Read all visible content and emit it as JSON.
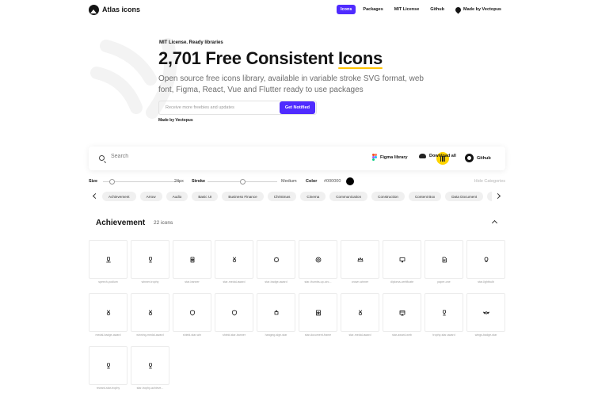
{
  "nav": {
    "brand": "Atlas icons",
    "links": [
      "Icons",
      "Packages",
      "MIT License",
      "Github"
    ],
    "vectopus": "Made by Vectopus",
    "accent": "#4f2bff"
  },
  "hero": {
    "eyebrow": "MIT License. Ready libraries",
    "headline_pre": "2,701 Free Consistent ",
    "headline_accent": "Icons",
    "subtitle": "Open source free icons library, available in variable stroke SVG format, web font, Figma, React, Vue and Flutter ready to use packages",
    "email_placeholder": "Receive more freebies and updates",
    "cta": "Get Notified",
    "madeby": "Made by Vectopus",
    "underline_color": "#ffc400"
  },
  "searchbar": {
    "placeholder": "Search",
    "figma": "Figma library",
    "download": "Download all",
    "github": "Github"
  },
  "controls": {
    "size_label": "Size",
    "size_value": "24px",
    "size_level": 0.12,
    "stroke_label": "Stroke",
    "stroke_value": "Medium",
    "stroke_level": 0.5,
    "color_label": "Color",
    "color_hex": "#000000",
    "hide": "Hide Categories"
  },
  "categories": [
    "Achievement",
    "Arrow",
    "Audio",
    "Basic UI",
    "Business Finance",
    "Christmas",
    "Cinema",
    "Communication",
    "Construction",
    "Content Box",
    "Data Document",
    "Ecology"
  ],
  "section": {
    "title": "Achievement",
    "count": "22 icons"
  },
  "icons": [
    {
      "name": "speech-podium",
      "icon": "podium-icon"
    },
    {
      "name": "winner-trophy",
      "icon": "trophy-icon"
    },
    {
      "name": "star-banner",
      "icon": "banner-icon"
    },
    {
      "name": "star-medal-award",
      "icon": "medal-icon"
    },
    {
      "name": "star-badge-award",
      "icon": "badge-icon"
    },
    {
      "name": "star-thumbs-up-circ...",
      "icon": "circle-icon"
    },
    {
      "name": "crown-winner",
      "icon": "crown-icon"
    },
    {
      "name": "diploma-certificate",
      "icon": "certificate-icon"
    },
    {
      "name": "paper-one",
      "icon": "paper-icon"
    },
    {
      "name": "star-lightbulb",
      "icon": "lightbulb-icon"
    },
    {
      "name": "medal-badge-award",
      "icon": "medal-icon"
    },
    {
      "name": "winning-medal-award",
      "icon": "medal-icon"
    },
    {
      "name": "shield-star-win",
      "icon": "shield-icon"
    },
    {
      "name": "shield-star-banner",
      "icon": "shield-icon"
    },
    {
      "name": "hanging-sign-star",
      "icon": "sign-icon"
    },
    {
      "name": "star-document-frame",
      "icon": "document-icon"
    },
    {
      "name": "star-medal-award",
      "icon": "medal-icon"
    },
    {
      "name": "star-award-web",
      "icon": "web-icon"
    },
    {
      "name": "trophy-star-award",
      "icon": "trophy-icon"
    },
    {
      "name": "wings-badge-star",
      "icon": "wings-icon"
    },
    {
      "name": "reward-star-trophy",
      "icon": "trophy-icon"
    },
    {
      "name": "star-trophy-achieve...",
      "icon": "trophy-icon"
    }
  ]
}
